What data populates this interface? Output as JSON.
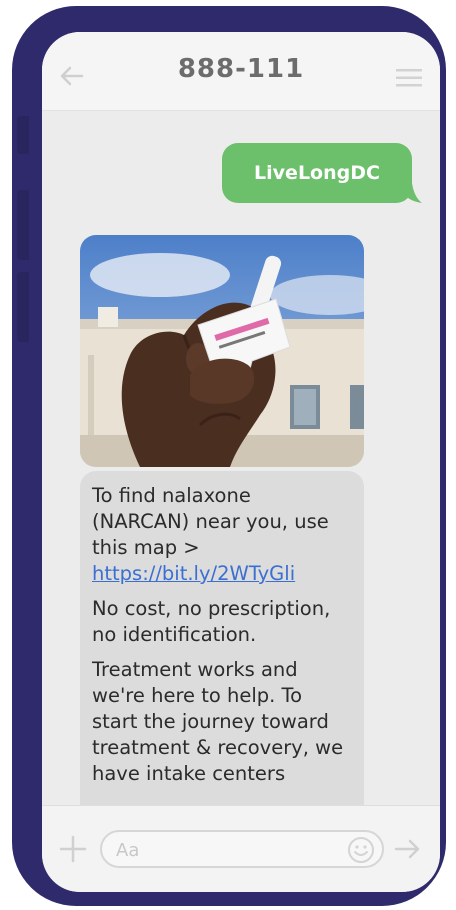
{
  "header": {
    "title": "888-111",
    "back_icon": "arrow-left-icon",
    "menu_icon": "hamburger-menu-icon"
  },
  "messages": {
    "outgoing": {
      "text": "LiveLongDC",
      "color": "#6cbf6b"
    },
    "incoming_image": {
      "subject": "hand holding naloxone nasal spray"
    },
    "incoming_text": {
      "line1": "To find nalaxone (NARCAN) near you, use this map >",
      "link": "https://bit.ly/2WTyGli",
      "line2": "No cost, no prescription, no identification.",
      "line3": "Treatment works and we're here to help. To start the journey toward treatment & recovery, we have intake centers"
    }
  },
  "composer": {
    "placeholder": "Aa",
    "plus_icon": "plus-icon",
    "emoji_icon": "smiley-icon",
    "send_icon": "send-arrow-icon"
  },
  "colors": {
    "frame": "#2e2a6b",
    "screen_bg": "#ececec",
    "incoming_bubble": "#dcdcdc",
    "link": "#3b6fd1"
  }
}
